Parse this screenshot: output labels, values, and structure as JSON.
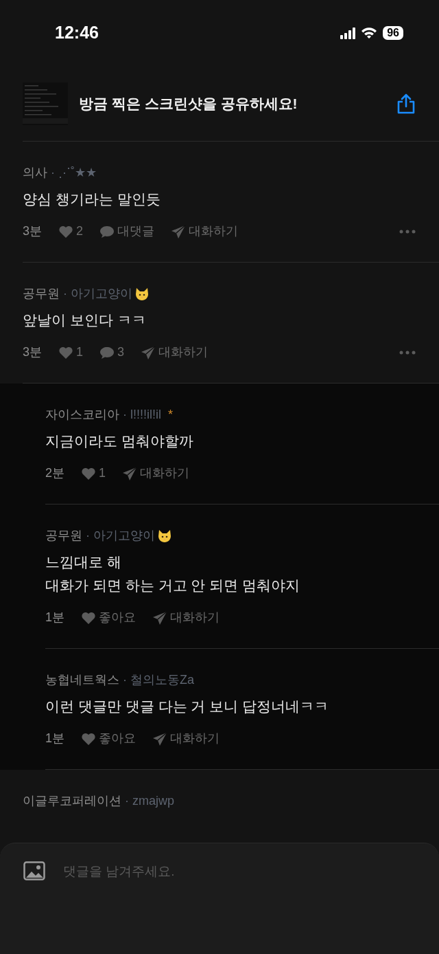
{
  "status_bar": {
    "time": "12:46",
    "battery": "96"
  },
  "share_banner": {
    "title": "방금 찍은 스크린샷을 공유하세요!"
  },
  "comments": [
    {
      "author": "의사",
      "separator": "·",
      "flair": "⋰˚★★",
      "body": [
        "양심 챙기라는 말인듯"
      ],
      "time": "3분",
      "likes": "2",
      "replies": "대댓글",
      "chat": "대화하기",
      "more": true,
      "is_reply": false
    },
    {
      "author": "공무원",
      "separator": "·",
      "flair": "아기고양이",
      "badge": {
        "kind": "cat"
      },
      "body": [
        "앞날이 보인다 ㅋㅋ"
      ],
      "time": "3분",
      "likes": "1",
      "replies": "3",
      "chat": "대화하기",
      "more": true,
      "is_reply": false
    },
    {
      "author": "자이스코리아",
      "separator": "·",
      "flair": "l!!!!il!il",
      "badge": {
        "kind": "text",
        "text": "*"
      },
      "body": [
        "지금이라도 멈춰야할까"
      ],
      "time": "2분",
      "likes": "1",
      "chat": "대화하기",
      "more": false,
      "is_reply": true
    },
    {
      "author": "공무원",
      "separator": "·",
      "flair": "아기고양이",
      "badge": {
        "kind": "cat"
      },
      "body": [
        "느낌대로 해",
        "대화가 되면 하는 거고 안 되면 멈춰야지"
      ],
      "time": "1분",
      "likes": "좋아요",
      "chat": "대화하기",
      "more": false,
      "is_reply": true
    },
    {
      "author": "농협네트웍스",
      "separator": "·",
      "flair": "철의노동Za",
      "body": [
        "이런 댓글만 댓글 다는 거 보니 답정너네ㅋㅋ"
      ],
      "time": "1분",
      "likes": "좋아요",
      "chat": "대화하기",
      "more": false,
      "is_reply": true
    },
    {
      "author": "이글루코퍼레이션",
      "separator": "·",
      "flair": "zmajwp",
      "is_reply": false
    }
  ],
  "composer": {
    "placeholder": "댓글을 남겨주세요."
  }
}
